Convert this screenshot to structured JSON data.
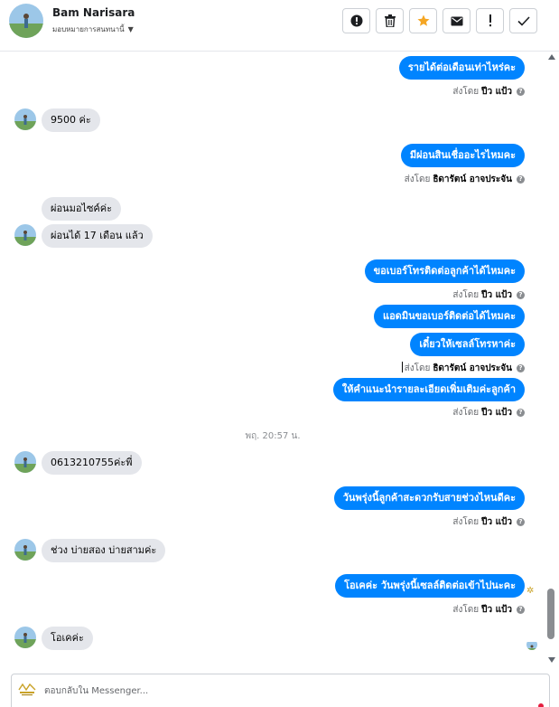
{
  "header": {
    "name": "Bam Narisara",
    "assign_label": "มอบหมายการสนทนานี้",
    "actions": [
      {
        "name": "spam-button",
        "icon": "exclamation-circle-icon"
      },
      {
        "name": "delete-button",
        "icon": "trash-icon"
      },
      {
        "name": "star-button",
        "icon": "star-icon",
        "color": "#f5a623"
      },
      {
        "name": "mark-unread-button",
        "icon": "envelope-icon"
      },
      {
        "name": "follow-up-button",
        "icon": "exclamation-icon"
      },
      {
        "name": "mark-done-button",
        "icon": "checkmark-icon"
      }
    ]
  },
  "colors": {
    "outgoing_bubble": "#0084ff",
    "incoming_bubble": "#e4e6eb",
    "star": "#f5a623"
  },
  "messages": {
    "m1": "รายได้ต่อเดือนเท่าไหร่คะ",
    "m1_sent_prefix": "ส่งโดย",
    "m1_sender": "ปีว แป้ว",
    "m2": "9500 ค่ะ",
    "m3": "มีผ่อนสินเชื่ออะไรไหมคะ",
    "m3_sent_prefix": "ส่งโดย",
    "m3_sender": "ธิดารัตน์ อาจประจัน",
    "m4": "ผ่อนมอไซค์ค่ะ",
    "m5": "ผ่อนได้ 17 เดือน แล้ว",
    "m6": "ขอเบอร์โทรติดต่อลูกค้าได้ไหมคะ",
    "m6_sent_prefix": "ส่งโดย",
    "m6_sender": "ปีว แป้ว",
    "m7": "แอดมินขอเบอร์ติดต่อได้ไหมคะ",
    "m8": "เดี๋ยวให้เซลล์โทรหาค่ะ",
    "m8_sent_prefix": "ส่งโดย",
    "m8_sender": "ธิดารัตน์ อาจประจัน",
    "m9": "ให้คำแนะนำรายละเอียดเพิ่มเติมค่ะลูกค้า",
    "m9_sent_prefix": "ส่งโดย",
    "m9_sender": "ปีว แป้ว",
    "timestamp": "พฤ. 20:57 น.",
    "m10": "0613210755ค่ะพี่",
    "m11": "วันพรุ่งนี้ลูกค้าสะดวกรับสายช่วงไหนดีคะ",
    "m11_sent_prefix": "ส่งโดย",
    "m11_sender": "ปีว แป้ว",
    "m12": "ช่วง บ่ายสอง บ่ายสามค่ะ",
    "m13": "โอเคค่ะ วันพรุ่งนี้เซลล์ติดต่อเข้าไปนะคะ",
    "m13_sent_prefix": "ส่งโดย",
    "m13_sender": "ปีว แป้ว",
    "m14": "โอเคค่ะ"
  },
  "composer": {
    "placeholder": "ตอบกลับใน Messenger..."
  }
}
